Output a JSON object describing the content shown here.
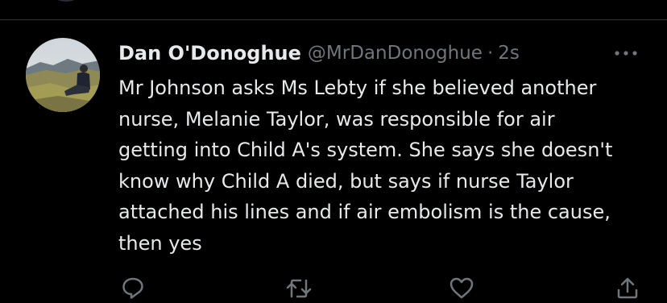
{
  "tweet": {
    "author_name": "Dan O'Donoghue",
    "author_handle": "@MrDanDonoghue",
    "separator": "·",
    "time": "2s",
    "text": "Mr Johnson asks Ms Lebty if she believed another\nnurse, Melanie Taylor, was responsible for air\ngetting into Child A's system. She says she doesn't\nknow why Child A died, but says if nurse Taylor\nattached his lines and if air embolism is the cause,\nthen yes"
  },
  "icons": {
    "more": "more-horizontal-icon",
    "reply": "reply-icon",
    "retweet": "retweet-icon",
    "like": "like-icon",
    "share": "share-icon"
  },
  "colors": {
    "background": "#000000",
    "text_primary": "#e7e9ea",
    "text_secondary": "#71767b",
    "divider": "#2f3336"
  }
}
